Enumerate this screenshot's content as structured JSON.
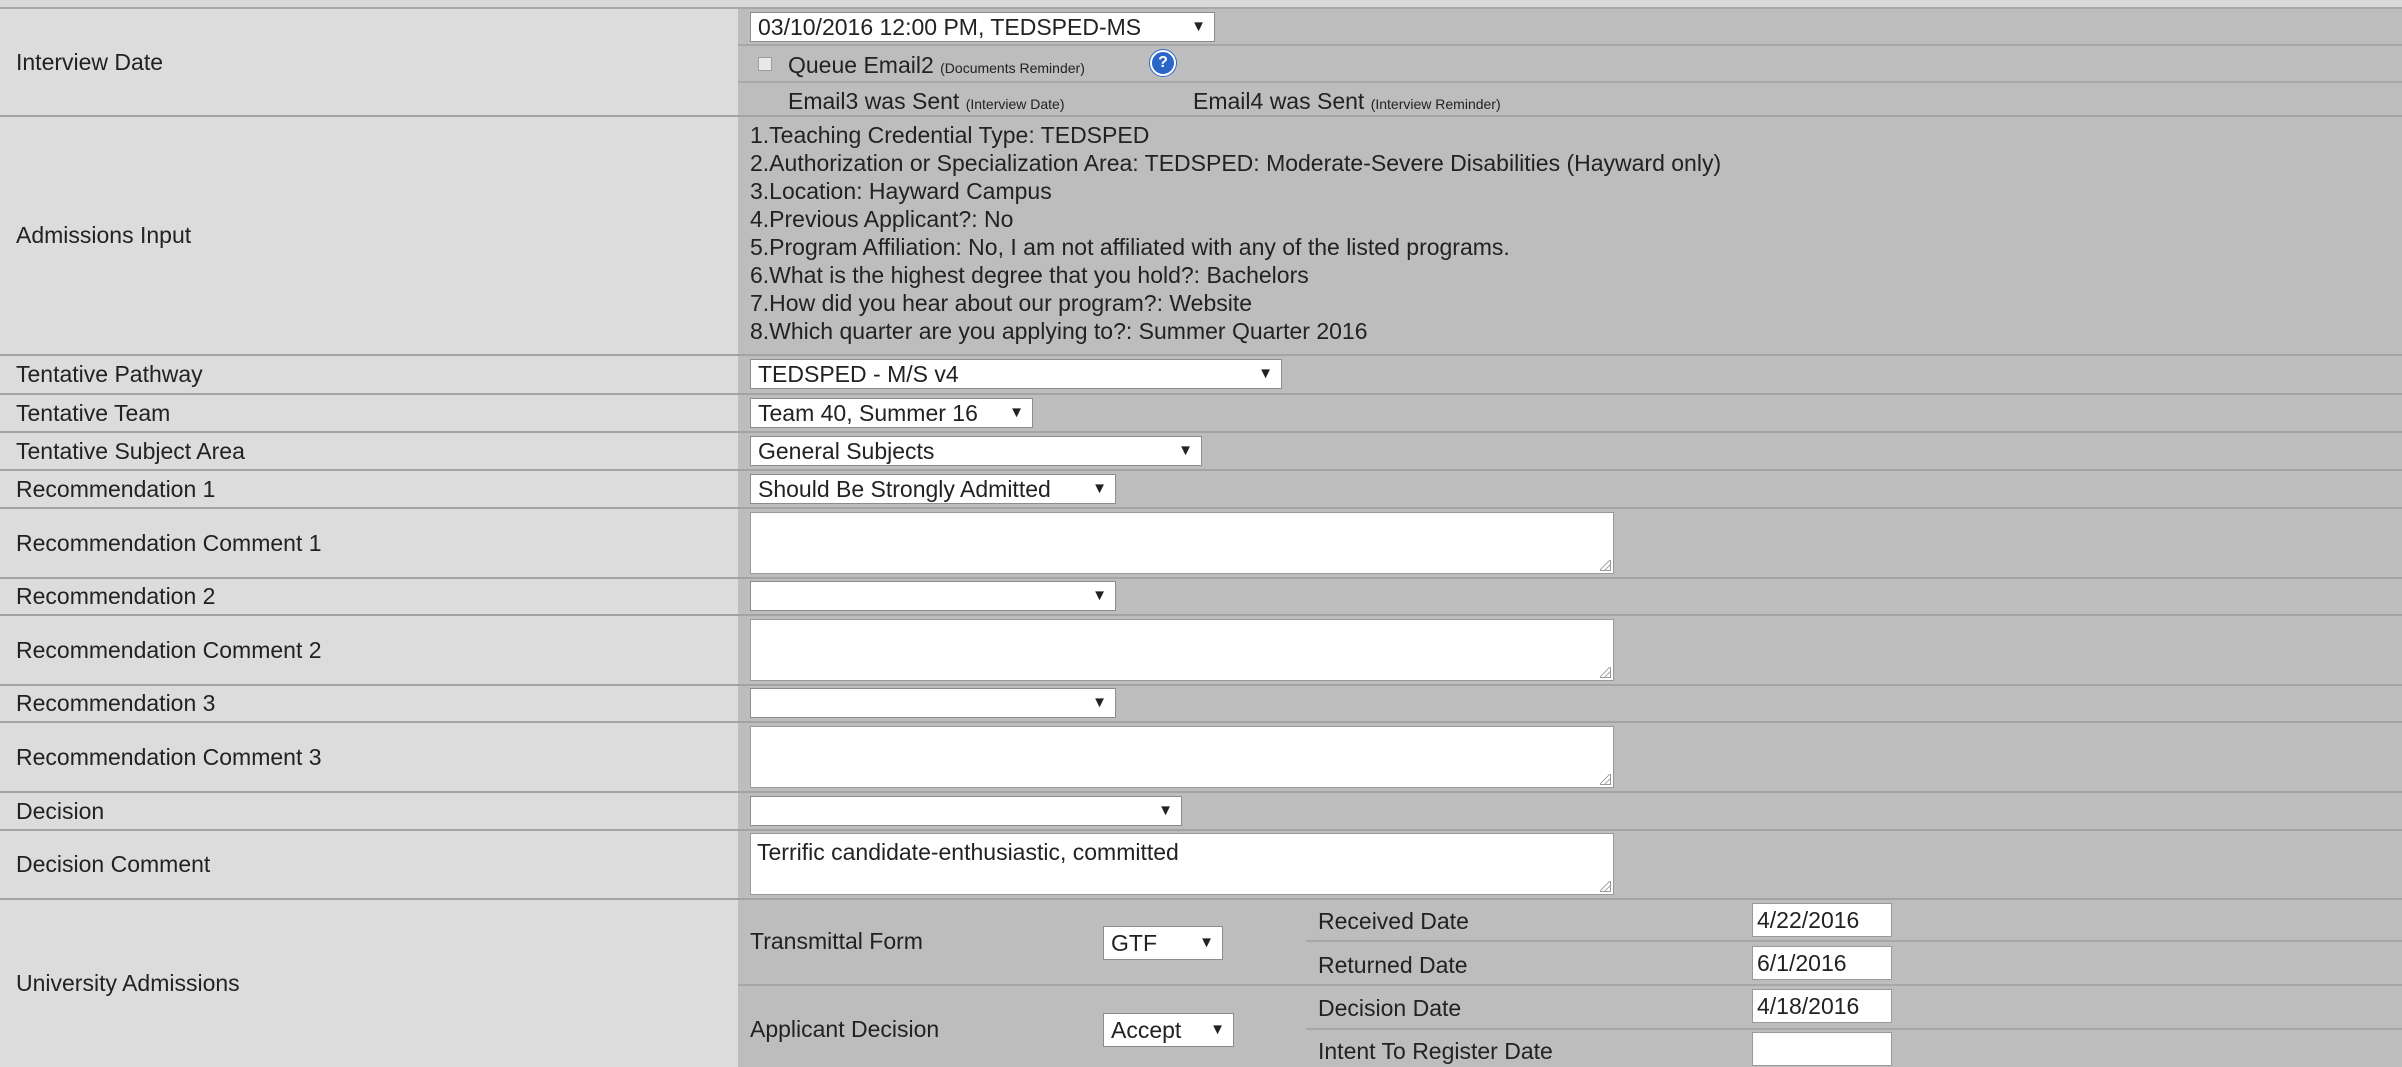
{
  "interview": {
    "label": "Interview Date",
    "selected": "03/10/2016 12:00 PM, TEDSPED-MS",
    "queue_email_label": "Queue Email2",
    "queue_email_note": "(Documents Reminder)",
    "help_icon": "?",
    "email3_text": "Email3 was Sent",
    "email3_note": "(Interview Date)",
    "email4_text": "Email4 was Sent",
    "email4_note": "(Interview Reminder)"
  },
  "admissions_input": {
    "label": "Admissions Input",
    "lines": [
      "1.Teaching Credential Type: TEDSPED",
      "2.Authorization or Specialization Area: TEDSPED: Moderate-Severe Disabilities (Hayward only)",
      "3.Location: Hayward Campus",
      "4.Previous Applicant?: No",
      "5.Program Affiliation: No, I am not affiliated with any of the listed programs.",
      "6.What is the highest degree that you hold?: Bachelors",
      "7.How did you hear about our program?: Website",
      "8.Which quarter are you applying to?: Summer Quarter 2016"
    ]
  },
  "tentative_pathway": {
    "label": "Tentative Pathway",
    "selected": "TEDSPED - M/S v4"
  },
  "tentative_team": {
    "label": "Tentative Team",
    "selected": "Team 40, Summer 16"
  },
  "tentative_subject": {
    "label": "Tentative Subject Area",
    "selected": "General Subjects"
  },
  "recommendation1": {
    "label": "Recommendation 1",
    "selected": "Should Be Strongly Admitted"
  },
  "rec_comment1": {
    "label": "Recommendation Comment 1",
    "value": ""
  },
  "recommendation2": {
    "label": "Recommendation 2",
    "selected": ""
  },
  "rec_comment2": {
    "label": "Recommendation Comment 2",
    "value": ""
  },
  "recommendation3": {
    "label": "Recommendation 3",
    "selected": ""
  },
  "rec_comment3": {
    "label": "Recommendation Comment 3",
    "value": ""
  },
  "decision": {
    "label": "Decision",
    "selected": ""
  },
  "decision_comment": {
    "label": "Decision Comment",
    "value": "Terrific candidate-enthusiastic, committed"
  },
  "university_admissions": {
    "label": "University Admissions",
    "transmittal_label": "Transmittal Form",
    "transmittal_selected": "GTF",
    "applicant_decision_label": "Applicant Decision",
    "applicant_decision_selected": "Accept",
    "received_label": "Received Date",
    "received_value": "4/22/2016",
    "returned_label": "Returned Date",
    "returned_value": "6/1/2016",
    "decision_date_label": "Decision Date",
    "decision_date_value": "4/18/2016",
    "intent_label": "Intent To Register Date",
    "intent_value": ""
  },
  "dropdown_arrow": "▼"
}
